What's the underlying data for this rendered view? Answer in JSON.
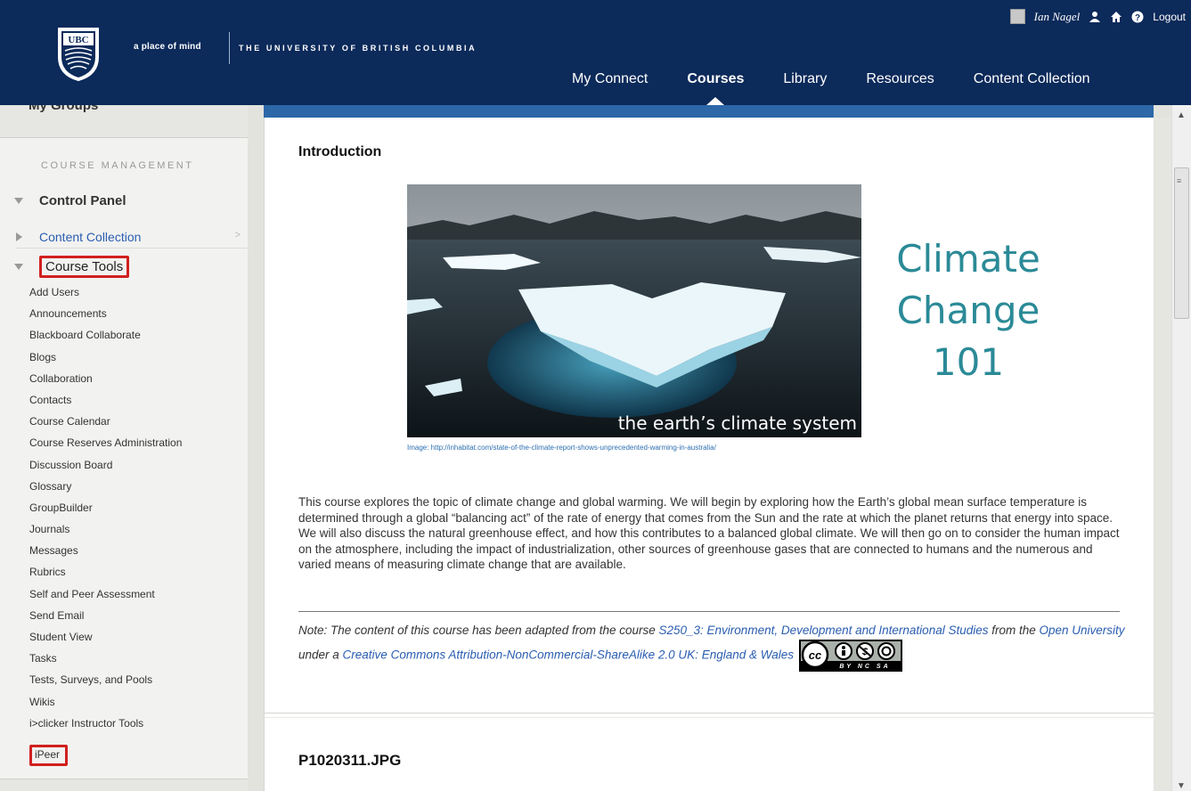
{
  "header": {
    "tagline": "a place of mind",
    "university": "THE UNIVERSITY OF BRITISH COLUMBIA",
    "crest_text": "UBC",
    "user_name": "Ian Nagel",
    "logout": "Logout",
    "nav": [
      "My Connect",
      "Courses",
      "Library",
      "Resources",
      "Content Collection"
    ],
    "active_nav": "Courses",
    "brand_color": "#0c2a5a"
  },
  "sidebar": {
    "top_item": "My Groups",
    "section_heading": "COURSE MANAGEMENT",
    "control_panel": "Control Panel",
    "content_collection": "Content Collection",
    "course_tools": "Course Tools",
    "tools": [
      "Add Users",
      "Announcements",
      "Blackboard Collaborate",
      "Blogs",
      "Collaboration",
      "Contacts",
      "Course Calendar",
      "Course Reserves Administration",
      "Discussion Board",
      "Glossary",
      "GroupBuilder",
      "Journals",
      "Messages",
      "Rubrics",
      "Self and Peer Assessment",
      "Send Email",
      "Student View",
      "Tasks",
      "Tests, Surveys, and Pools",
      "Wikis",
      "i>clicker Instructor Tools"
    ],
    "highlighted_tool": "iPeer",
    "highlight_color": "#d0201e"
  },
  "content": {
    "intro_title": "Introduction",
    "hero_overlay": "the earth’s climate system",
    "hero_heading": [
      "Climate",
      "Change",
      "101"
    ],
    "image_caption": "Image: http://inhabitat.com/state-of-the-climate-report-shows-unprecedented-warming-in-australia/",
    "body": "This course explores the topic of climate change and global warming. We will begin by exploring how the Earth’s global mean surface temperature is determined through a global “balancing act” of the rate of energy that comes from the Sun and the rate at which the planet returns that energy into space. We will also discuss the natural greenhouse effect, and how this contributes to a balanced global climate. We will then go on to consider the human impact on the atmosphere, including the impact of industrialization, other sources of greenhouse gases that are connected to humans and the numerous and varied means of measuring climate change that are available.",
    "note_prefix": "Note: The content of this course has been adapted from the course ",
    "note_link_course": "S250_3: Environment, Development and International Studies",
    "note_from": " from the ",
    "note_link_ou": "Open University",
    "note_under": " under a ",
    "note_link_license": "Creative Commons Attribution-NonCommercial-ShareAlike 2.0 UK: England & Wales",
    "cc_badge_text": "BY NC SA",
    "next_item_title": "P1020311.JPG",
    "accent_teal": "#2b8a97"
  }
}
